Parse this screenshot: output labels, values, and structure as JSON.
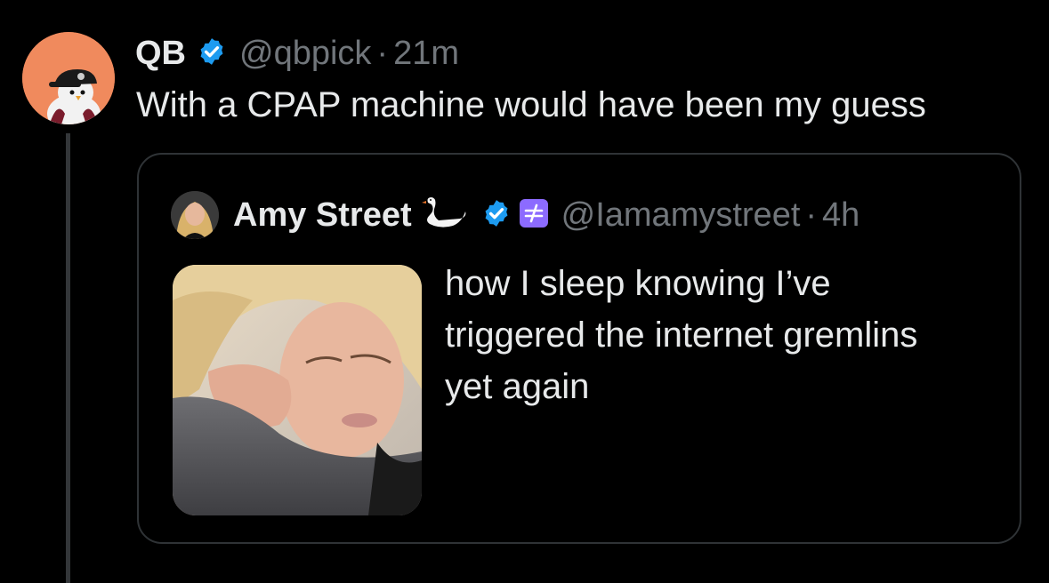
{
  "tweet": {
    "display_name": "QB",
    "verified": true,
    "handle": "@qbpick",
    "separator": "·",
    "time": "21m",
    "text": "With a CPAP machine would have been my guess",
    "avatar_icon": "penguin-avatar-icon",
    "avatar_bg": "#f08a5d"
  },
  "quoted": {
    "display_name": "Amy Street",
    "emoji_icon": "swan-emoji-icon",
    "verified": true,
    "affiliate_icon": "affiliate-badge-icon",
    "handle": "@Iamamystreet",
    "separator": "·",
    "time": "4h",
    "text_lines": [
      "how I sleep knowing I’ve",
      "triggered the internet gremlins",
      "yet again"
    ]
  },
  "colors": {
    "background": "#000000",
    "primary_text": "#e7e9ea",
    "secondary_text": "#71767b",
    "border": "#2f3336",
    "verified_blue": "#1d9bf0",
    "affiliate_purple": "#8c6bff"
  }
}
